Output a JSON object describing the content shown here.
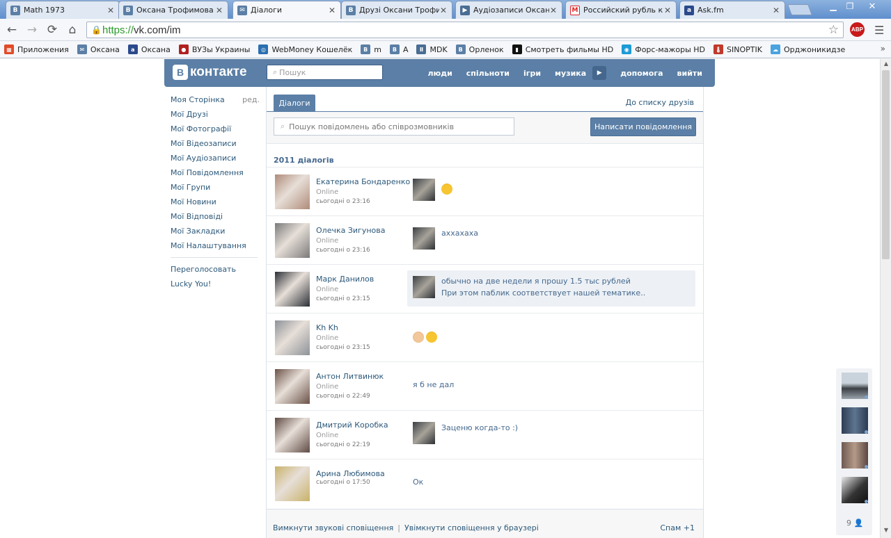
{
  "browser": {
    "tabs": [
      {
        "title": "Math 1973",
        "icon": "vk-icon",
        "active": false
      },
      {
        "title": "Оксана Трофимова",
        "icon": "vk-icon",
        "active": false
      },
      {
        "title": "Діалоги",
        "icon": "vk-message-icon",
        "active": true
      },
      {
        "title": "Друзі Оксани Трофимової",
        "icon": "vk-icon",
        "active": false
      },
      {
        "title": "Аудіозаписи Оксани",
        "icon": "play-icon",
        "active": false
      },
      {
        "title": "Российский рубль к г",
        "icon": "m-icon",
        "active": false
      },
      {
        "title": "Ask.fm",
        "icon": "askfm-icon",
        "active": false
      }
    ],
    "url_scheme": "https://",
    "url_rest": "vk.com/im",
    "bookmarks": [
      {
        "label": "Приложения",
        "icon": "apps-icon",
        "color": "#e04b2a"
      },
      {
        "label": "Оксана",
        "icon": "message-icon",
        "color": "#5b7fa6"
      },
      {
        "label": "Оксана",
        "icon": "askfm-icon",
        "color": "#2b4a8c"
      },
      {
        "label": "ВУЗы Украины",
        "icon": "seal-icon",
        "color": "#b12020"
      },
      {
        "label": "WebMoney Кошелёк",
        "icon": "webmoney-icon",
        "color": "#2a6fb0"
      },
      {
        "label": "m",
        "icon": "vk-icon",
        "color": "#5b7fa6"
      },
      {
        "label": "А",
        "icon": "vk-icon",
        "color": "#5b7fa6"
      },
      {
        "label": "MDK",
        "icon": "mdk-icon",
        "color": "#4a6d93"
      },
      {
        "label": "Орленок",
        "icon": "vk-icon",
        "color": "#5b7fa6"
      },
      {
        "label": "Смотреть фильмы HD",
        "icon": "film-icon",
        "color": "#111111"
      },
      {
        "label": "Форс-мажоры HD",
        "icon": "eye-icon",
        "color": "#1c9bd6"
      },
      {
        "label": "SINOPTIK",
        "icon": "thermometer-icon",
        "color": "#c0392b"
      },
      {
        "label": "Орджоникидзе",
        "icon": "weather-icon",
        "color": "#4aa3df"
      }
    ]
  },
  "header": {
    "logo": "контакте",
    "logo_mark": "В",
    "search_placeholder": "Пошук",
    "nav": [
      "люди",
      "спільноти",
      "ігри",
      "музика",
      "допомога",
      "вийти"
    ]
  },
  "sidebar": {
    "items": [
      "Моя Сторінка",
      "Мої Друзі",
      "Мої Фотографії",
      "Мої Відеозаписи",
      "Мої Аудіозаписи",
      "Мої Повідомлення",
      "Мої Групи",
      "Мої Новини",
      "Мої Відповіді",
      "Мої Закладки",
      "Мої Налаштування"
    ],
    "edit_label": "ред.",
    "extra": [
      "Переголосовать",
      "Lucky You!"
    ]
  },
  "main": {
    "tab_label": "Діалоги",
    "friends_link": "До списку друзів",
    "search_placeholder": "Пошук повідомлень або співрозмовників",
    "write_button": "Написати повідомлення",
    "count_label": "2011 діалогів",
    "dialogs": [
      {
        "name": "Екатерина Бондаренко",
        "status": "Online",
        "time": "сьогодні о 23:16",
        "text": "",
        "emoji": [
          "laugh-tears-emoji"
        ],
        "own": true,
        "unread": false,
        "avatar": "#b08b79"
      },
      {
        "name": "Олечка Зигунова",
        "status": "Online",
        "time": "сьогодні о 23:16",
        "text": "аххахаха",
        "emoji": [],
        "own": true,
        "unread": false,
        "avatar": "#7a7a7a"
      },
      {
        "name": "Марк Данилов",
        "status": "Online",
        "time": "сьогодні о 23:15",
        "text": "обычно на две недели я прошу 1.5 тыс рублей\nПри этом паблик соответствует нашей тематике..",
        "emoji": [],
        "own": true,
        "unread": true,
        "avatar": "#2b2f36"
      },
      {
        "name": "Kh Kh",
        "status": "Online",
        "time": "сьогодні о 23:15",
        "text": "",
        "emoji": [
          "ok-hand-emoji",
          "smirk-emoji"
        ],
        "own": false,
        "unread": false,
        "avatar": "#8d9298"
      },
      {
        "name": "Антон Литвинюк",
        "status": "Online",
        "time": "сьогодні о 22:49",
        "text": "я б не дал",
        "emoji": [],
        "own": false,
        "unread": false,
        "avatar": "#6b5248"
      },
      {
        "name": "Дмитрий Коробка",
        "status": "Online",
        "time": "сьогодні о 22:19",
        "text": "Заценю когда-то :)",
        "emoji": [],
        "own": true,
        "unread": false,
        "avatar": "#5f4a44"
      },
      {
        "name": "Арина Любимова",
        "status": "",
        "time": "сьогодні о 17:50",
        "text": "Ок",
        "emoji": [],
        "own": false,
        "unread": false,
        "avatar": "#c9b26a"
      }
    ],
    "footer_sound": "Вимкнути звукові сповіщення",
    "footer_browser": "Увімкнути сповіщення у браузері",
    "footer_spam": "Спам +1"
  },
  "right_bar": {
    "count": "9"
  }
}
